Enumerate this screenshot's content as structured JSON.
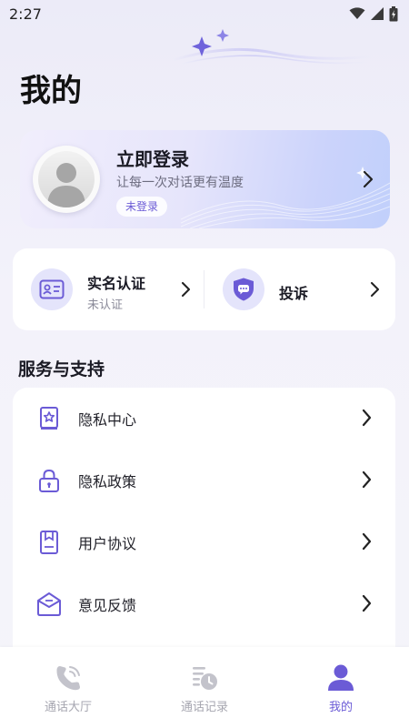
{
  "status_bar": {
    "time": "2:27"
  },
  "page": {
    "title": "我的"
  },
  "login": {
    "title": "立即登录",
    "subtitle": "让每一次对话更有温度",
    "badge": "未登录"
  },
  "quick_actions": [
    {
      "title": "实名认证",
      "subtitle": "未认证",
      "icon": "id-card-icon"
    },
    {
      "title": "投诉",
      "subtitle": "",
      "icon": "shield-chat-icon"
    }
  ],
  "services": {
    "title": "服务与支持",
    "items": [
      {
        "label": "隐私中心",
        "icon": "privacy-center-icon"
      },
      {
        "label": "隐私政策",
        "icon": "lock-icon"
      },
      {
        "label": "用户协议",
        "icon": "document-icon"
      },
      {
        "label": "意见反馈",
        "icon": "feedback-icon"
      }
    ]
  },
  "tabs": [
    {
      "label": "通话大厅",
      "icon": "phone-icon",
      "active": false
    },
    {
      "label": "通话记录",
      "icon": "call-history-icon",
      "active": false
    },
    {
      "label": "我的",
      "icon": "user-icon",
      "active": true
    }
  ],
  "colors": {
    "accent": "#6b5bd6",
    "icon_bg": "#e4e4fb",
    "inactive": "#a6a6b0"
  }
}
